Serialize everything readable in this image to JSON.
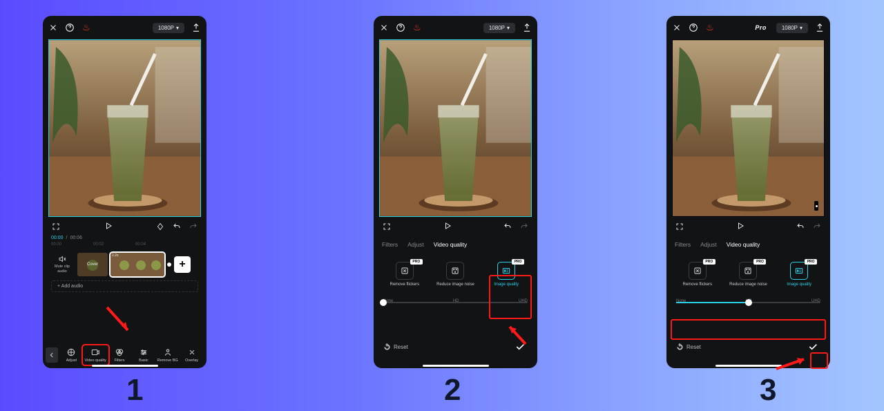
{
  "steps": {
    "s1": "1",
    "s2": "2",
    "s3": "3"
  },
  "topbar": {
    "resolution": "1080P",
    "pro": "Pro"
  },
  "time": {
    "current": "00:00",
    "total": "00:06"
  },
  "ruler": [
    "00:00",
    "00:02",
    "00:04"
  ],
  "timeline": {
    "mute": "Mute clip audio",
    "cover": "Cover",
    "len": "2.2s",
    "add_audio": "+ Add audio"
  },
  "tools1": {
    "adjust": "Adjust",
    "video_quality": "Video quality",
    "filters": "Filters",
    "basic": "Basic",
    "remove_bg": "Remove BG",
    "overlay": "Overlay"
  },
  "tabs": {
    "filters": "Filters",
    "adjust": "Adjust",
    "video_quality": "Video quality"
  },
  "quality_items": {
    "remove_flickers": "Remove flickers",
    "reduce_noise": "Reduce image noise",
    "image_quality": "Image quality",
    "badge": "PRO"
  },
  "slider": {
    "none": "None",
    "hd": "HD",
    "uhd": "UHD"
  },
  "reset": "Reset"
}
